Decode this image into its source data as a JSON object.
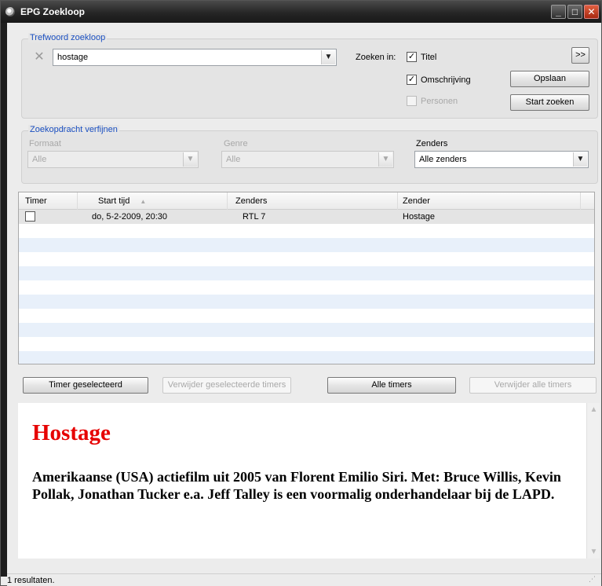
{
  "window": {
    "title": "EPG Zoekloop",
    "icon": "app-icon",
    "controls": {
      "minimize": "_",
      "maximize": "□",
      "close": "✕"
    }
  },
  "keyword": {
    "group_title": "Trefwoord zoekloop",
    "clear_icon": "✕",
    "value": "hostage",
    "search_in_label": "Zoeken in:",
    "options": [
      {
        "label": "Titel",
        "checked": true,
        "enabled": true
      },
      {
        "label": "Omschrijving",
        "checked": true,
        "enabled": true
      },
      {
        "label": "Personen",
        "checked": false,
        "enabled": false
      }
    ],
    "expand_label": ">>",
    "save_label": "Opslaan",
    "start_label": "Start zoeken"
  },
  "refine": {
    "group_title": "Zoekopdracht verfijnen",
    "format": {
      "label": "Formaat",
      "value": "Alle",
      "enabled": false
    },
    "genre": {
      "label": "Genre",
      "value": "Alle",
      "enabled": false
    },
    "channels": {
      "label": "Zenders",
      "value": "Alle zenders",
      "enabled": true
    }
  },
  "results": {
    "columns": [
      "Timer",
      "Start tijd",
      "Zenders",
      "Zender"
    ],
    "sort_indicator": "▲",
    "rows": [
      {
        "timer": false,
        "start": "do, 5-2-2009, 20:30",
        "channel": "RTL 7",
        "title": "Hostage"
      }
    ]
  },
  "actions": {
    "timer_selected": "Timer geselecteerd",
    "remove_selected": "Verwijder geselecteerde timers",
    "all_timers": "Alle timers",
    "remove_all": "Verwijder alle timers"
  },
  "detail": {
    "title": "Hostage",
    "description": "Amerikaanse (USA) actiefilm uit 2005 van Florent Emilio Siri. Met: Bruce Willis, Kevin Pollak, Jonathan Tucker e.a. Jeff Talley is een voormalig onderhandelaar bij de LAPD.",
    "title_color": "#e60000"
  },
  "status": {
    "text": "1 resultaten."
  }
}
